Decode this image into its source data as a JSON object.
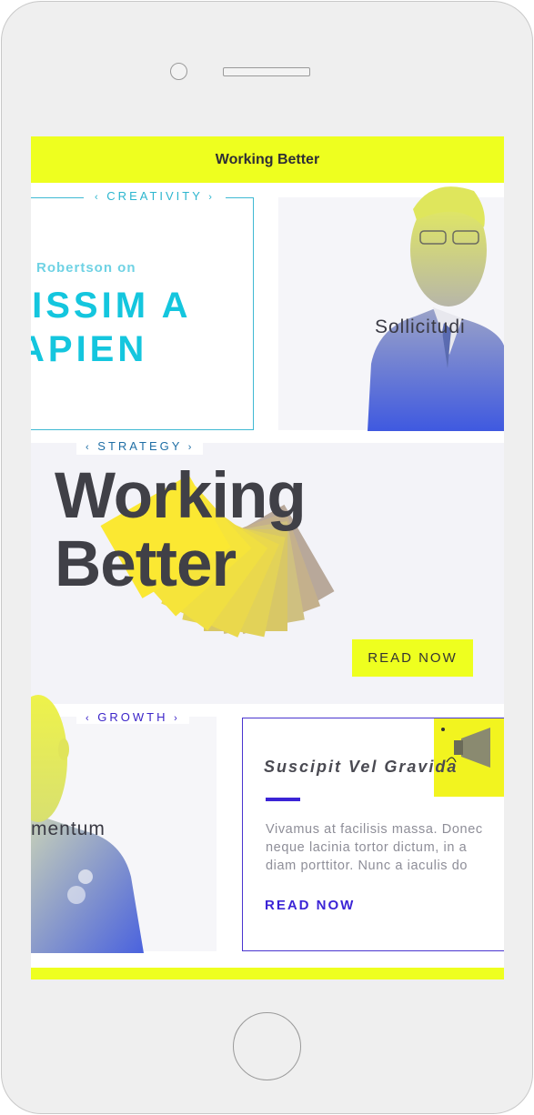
{
  "device": {
    "name": "phone-mockup"
  },
  "header": {
    "title": "Working Better"
  },
  "creativity": {
    "label": "CREATIVITY",
    "subtitle": "Robertson on",
    "title_line1": "IISSIM A",
    "title_line2": "APIEN"
  },
  "portrait": {
    "caption": "Sollicitudi"
  },
  "strategy": {
    "label": "STRATEGY",
    "title_line1": "Working",
    "title_line2": "Better",
    "button": "READ NOW"
  },
  "growth": {
    "label": "GROWTH",
    "caption": "mentum"
  },
  "article": {
    "title": "Suscipit Vel Gravida",
    "body_line1": "Vivamus at facilisis massa. Donec",
    "body_line2": "neque lacinia tortor dictum, in a",
    "body_line3": "diam porttitor. Nunc a iaculis do",
    "link": "READ NOW"
  },
  "colors": {
    "accent_yellow": "#eeff1f",
    "cyan": "#14c6de",
    "violet": "#3b24d6",
    "dark": "#404047"
  },
  "icons": {
    "chevron_left": "chevron-left-icon",
    "chevron_right": "chevron-right-icon"
  }
}
